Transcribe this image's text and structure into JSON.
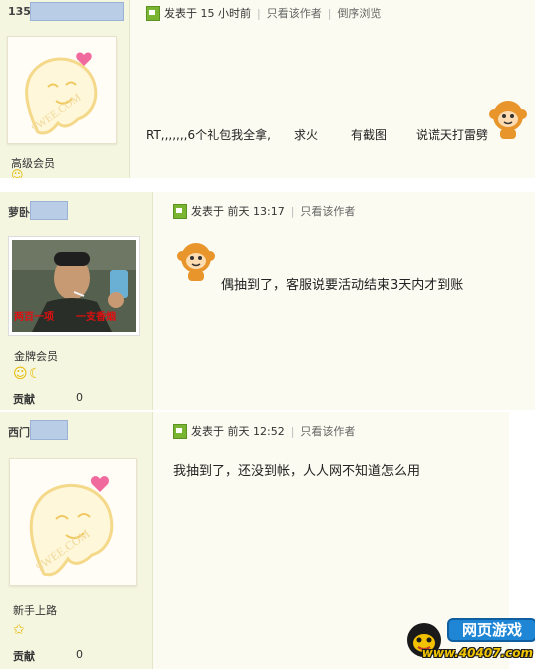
{
  "posts": [
    {
      "author_prefix": "135",
      "meta_prefix": "发表于",
      "time": "15 小时前",
      "only_author": "只看该作者",
      "reverse": "倒序浏览",
      "rank": "高级会员",
      "avatar_watermark": "9WEE.COM",
      "content_parts": [
        "RT,,,,,,,6个礼包我全拿,",
        "求火",
        "有截图",
        "说谎天打雷劈"
      ]
    },
    {
      "author_prefix": "萝卧",
      "meta_prefix": "发表于",
      "time": "前天 13:17",
      "only_author": "只看该作者",
      "rank": "金牌会员",
      "contrib_label": "贡献",
      "contrib_value": "0",
      "avatar_caption_left": "两百一项",
      "avatar_caption_right": "一支香烟",
      "content": "偶抽到了，客服说要活动结束3天内才到账"
    },
    {
      "author_prefix": "西门",
      "meta_prefix": "发表于",
      "time": "前天 12:52",
      "only_author": "只看该作者",
      "rank": "新手上路",
      "contrib_label": "贡献",
      "contrib_value": "0",
      "avatar_watermark": "9WEE.COM",
      "content": "我抽到了，还没到帐，人人网不知道怎么用"
    }
  ],
  "ad": {
    "title": "网页游戏",
    "url": "www.40407.com"
  },
  "icons": {
    "post_icon": "post-icon",
    "smiley": "smiley-icon",
    "moon": "moon-icon",
    "star": "star-icon"
  }
}
